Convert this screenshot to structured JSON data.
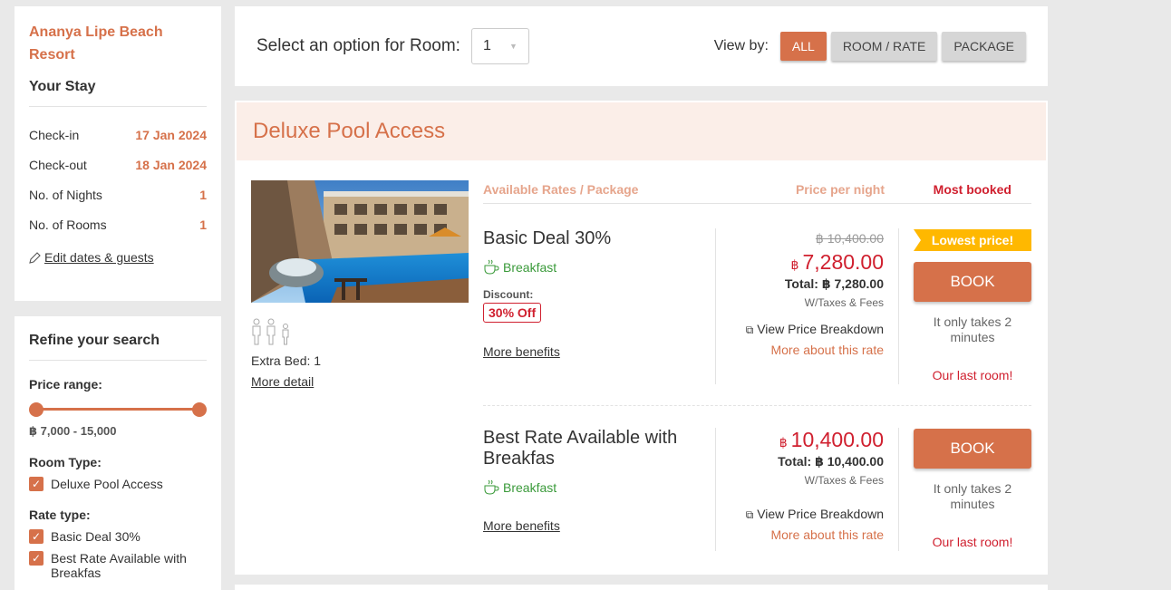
{
  "hotel": {
    "name_line1": "Ananya Lipe Beach",
    "name_line2": "Resort"
  },
  "stay": {
    "title": "Your Stay",
    "rows": [
      {
        "label": "Check-in",
        "value": "17 Jan 2024"
      },
      {
        "label": "Check-out",
        "value": "18 Jan 2024"
      },
      {
        "label": "No. of Nights",
        "value": "1"
      },
      {
        "label": "No. of Rooms",
        "value": "1"
      }
    ],
    "edit_label": "Edit dates & guests"
  },
  "refine": {
    "title": "Refine your search",
    "price_label": "Price range:",
    "price_text": "฿ 7,000 - 15,000",
    "room_type_label": "Room Type:",
    "room_types": [
      "Deluxe Pool Access"
    ],
    "rate_type_label": "Rate type:",
    "rate_types": [
      "Basic Deal 30%",
      "Best Rate Available with Breakfas"
    ]
  },
  "topbar": {
    "select_label": "Select an option for Room:",
    "select_value": "1",
    "viewby_label": "View by:",
    "buttons": [
      "ALL",
      "ROOM / RATE",
      "PACKAGE"
    ]
  },
  "room": {
    "name": "Deluxe Pool Access",
    "extra_bed": "Extra Bed: 1",
    "more_detail": "More detail",
    "head_rates": "Available Rates / Package",
    "head_price": "Price per night",
    "head_booked": "Most booked"
  },
  "rates": [
    {
      "name": "Basic Deal 30%",
      "breakfast": "Breakfast",
      "discount_label": "Discount:",
      "discount": "30% Off",
      "more_benefits": "More benefits",
      "old_price": "฿ 10,400.00",
      "currency": "฿",
      "price": "7,280.00",
      "total": "Total: ฿ 7,280.00",
      "taxes": "W/Taxes & Fees",
      "breakdown": "View Price Breakdown",
      "more_about": "More about this rate",
      "badge": "Lowest price!",
      "book": "BOOK",
      "takes": "It only takes 2 minutes",
      "last_room": "Our last room!"
    },
    {
      "name": "Best Rate Available with Breakfas",
      "breakfast": "Breakfast",
      "more_benefits": "More benefits",
      "currency": "฿",
      "price": "10,400.00",
      "total": "Total: ฿ 10,400.00",
      "taxes": "W/Taxes & Fees",
      "breakdown": "View Price Breakdown",
      "more_about": "More about this rate",
      "book": "BOOK",
      "takes": "It only takes 2 minutes",
      "last_room": "Our last room!"
    }
  ],
  "colors": {
    "accent": "#d6714a",
    "price_red": "#d0202f",
    "breakfast_green": "#3a9a3a",
    "badge_yellow": "#ffb800"
  }
}
